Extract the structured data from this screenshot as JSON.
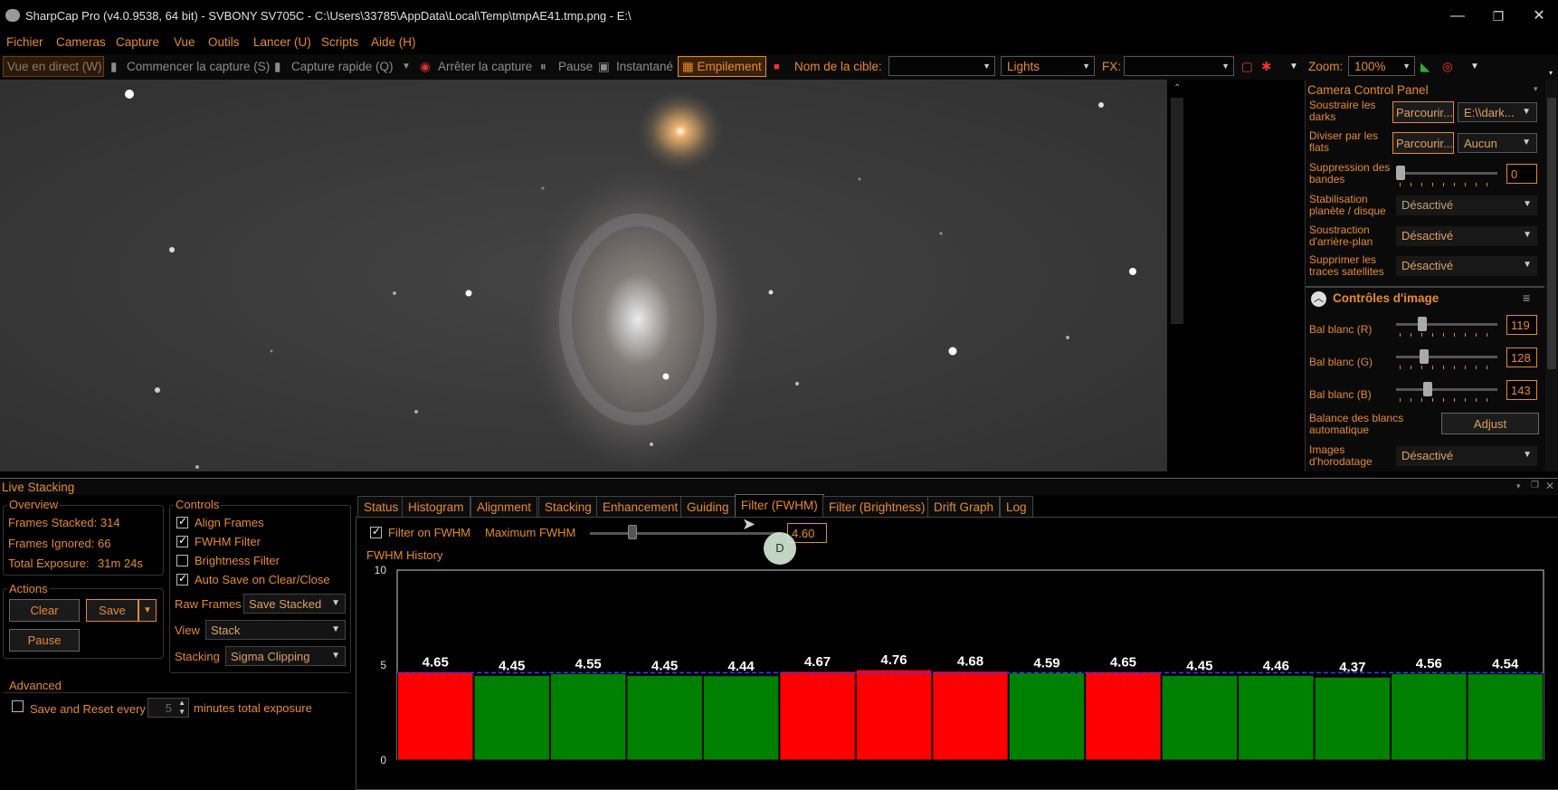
{
  "window": {
    "title": "SharpCap Pro (v4.0.9538, 64 bit) - SVBONY SV705C - C:\\Users\\33785\\AppData\\Local\\Temp\\tmpAE41.tmp.png - E:\\",
    "min": "—",
    "restore": "❐",
    "close": "✕"
  },
  "menu": [
    "Fichier",
    "Cameras",
    "Capture",
    "Vue",
    "Outils",
    "Lancer (U)",
    "Scripts",
    "Aide (H)"
  ],
  "toolbar": {
    "live_view": "Vue en direct (W)",
    "start_capture": "Commencer la capture (S)",
    "quick_capture": "Capture rapide (Q)",
    "stop_capture": "Arrêter la capture",
    "pause": "Pause",
    "snapshot": "Instantané",
    "stacking": "Empilement",
    "target_label": "Nom de la cible:",
    "target_value": "",
    "frame_type": "Lights",
    "fx_label": "FX:",
    "fx_value": "",
    "zoom_label": "Zoom:",
    "zoom_value": "100%"
  },
  "camera_panel": {
    "title": "Camera Control Panel",
    "darks_label": "Soustraire les darks",
    "darks_browse": "Parcourir...",
    "darks_value": "E:\\\\dark...",
    "flats_label": "Diviser par les flats",
    "flats_browse": "Parcourir...",
    "flats_value": "Aucun",
    "banding_label": "Suppression des bandes",
    "banding_value": "0",
    "stabilization_label": "Stabilisation planète / disque",
    "stabilization_value": "Désactivé",
    "background_label": "Soustraction d'arrière-plan",
    "background_value": "Désactivé",
    "satellite_label": "Supprimer les traces satellites",
    "satellite_value": "Désactivé",
    "image_controls_title": "Contrôles d'image",
    "wb_r_label": "Bal blanc (R)",
    "wb_r_value": "119",
    "wb_g_label": "Bal blanc (G)",
    "wb_g_value": "128",
    "wb_b_label": "Bal blanc (B)",
    "wb_b_value": "143",
    "auto_wb_label": "Balance des blancs automatique",
    "auto_wb_button": "Adjust",
    "timestamp_label": "Images d'horodatage",
    "timestamp_value": "Désactivé"
  },
  "live_stacking": {
    "title": "Live Stacking",
    "overview": {
      "title": "Overview",
      "frames_stacked": "Frames Stacked: 314",
      "frames_ignored": "Frames Ignored: 66",
      "total_exposure_label": "Total Exposure:",
      "total_exposure_value": "31m 24s"
    },
    "actions": {
      "title": "Actions",
      "clear": "Clear",
      "save": "Save",
      "pause": "Pause"
    },
    "advanced": {
      "title": "Advanced",
      "save_reset_label": "Save and Reset every",
      "minutes_value": "5",
      "minutes_suffix": "minutes total exposure"
    },
    "controls": {
      "title": "Controls",
      "align": "Align Frames",
      "fwhm": "FWHM Filter",
      "brightness": "Brightness Filter",
      "autosave": "Auto Save on Clear/Close",
      "raw_frames_label": "Raw Frames",
      "raw_frames_value": "Save Stacked",
      "view_label": "View",
      "view_value": "Stack",
      "stacking_label": "Stacking",
      "stacking_value": "Sigma Clipping"
    },
    "tabs": [
      "Status",
      "Histogram",
      "Alignment",
      "Stacking",
      "Enhancement",
      "Guiding",
      "Filter (FWHM)",
      "Filter (Brightness)",
      "Drift Graph",
      "Log"
    ],
    "fwhm_filter": {
      "filter_label": "Filter on FWHM",
      "max_label": "Maximum FWHM",
      "max_value": "4.60",
      "cursor_badge": "D",
      "history_title": "FWHM History"
    }
  },
  "chart_data": {
    "type": "bar",
    "title": "",
    "xlabel": "",
    "ylabel": "",
    "ylim": [
      0,
      10
    ],
    "yticks": [
      0,
      5,
      10
    ],
    "threshold": 4.6,
    "values": [
      4.65,
      4.45,
      4.55,
      4.45,
      4.44,
      4.67,
      4.76,
      4.68,
      4.59,
      4.65,
      4.45,
      4.46,
      4.37,
      4.56,
      4.54
    ],
    "labels": [
      "4.65",
      "4.45",
      "4.55",
      "4.45",
      "4.44",
      "4.67",
      "4.76",
      "4.68",
      "4.59",
      "4.65",
      "4.45",
      "4.46",
      "4.37",
      "4.56",
      "4.54"
    ],
    "colors": {
      "rejected": "#ff0000",
      "accepted": "#008000",
      "threshold_line": "#3a3aff"
    },
    "grid": false
  }
}
